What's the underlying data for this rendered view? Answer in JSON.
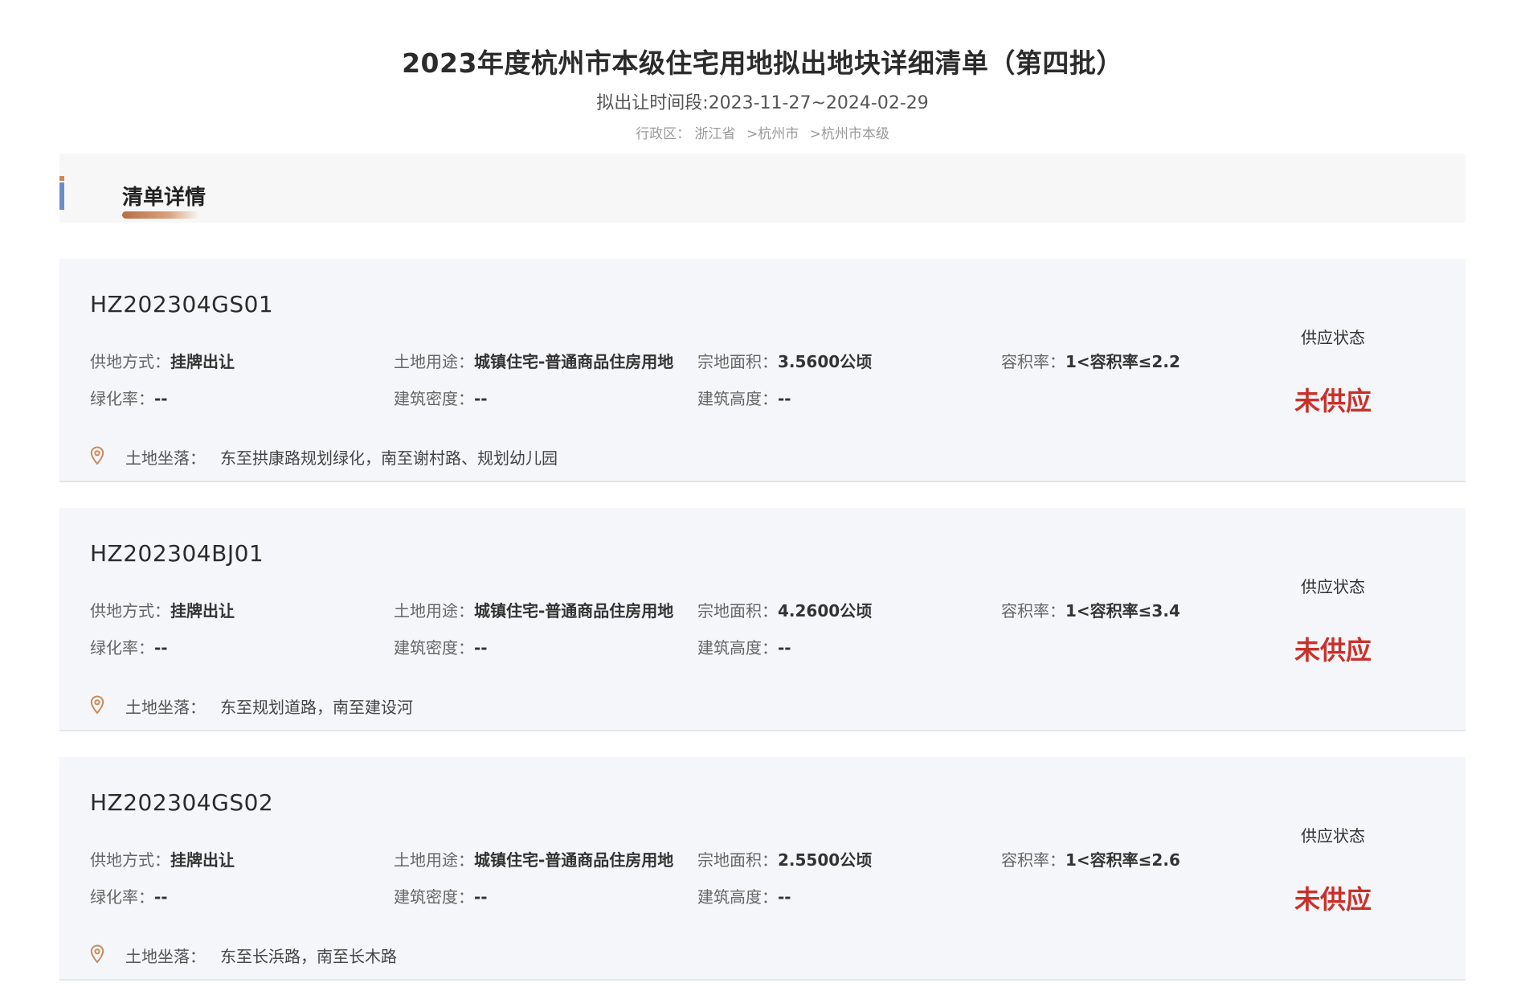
{
  "header": {
    "title": "2023年度杭州市本级住宅用地拟出地块详细清单（第四批）",
    "period": "拟出让时间段:2023-11-27~2024-02-29",
    "region_label": "行政区：",
    "region_province": "浙江省",
    "region_city": ">杭州市",
    "region_level": ">杭州市本级"
  },
  "section": {
    "title": "清单详情"
  },
  "labels": {
    "supply_method": "供地方式：",
    "land_use": "土地用途：",
    "area": "宗地面积：",
    "plot_ratio": "容积率：",
    "green_rate": "绿化率：",
    "building_density": "建筑密度：",
    "building_height": "建筑高度：",
    "location": "土地坐落：",
    "supply_status": "供应状态"
  },
  "parcels": [
    {
      "code": "HZ202304GS01",
      "supply_method": "挂牌出让",
      "land_use": "城镇住宅-普通商品住房用地",
      "area": "3.5600公顷",
      "plot_ratio": "1<容积率≤2.2",
      "green_rate": "--",
      "building_density": "--",
      "building_height": "--",
      "location": "东至拱康路规划绿化，南至谢村路、规划幼儿园",
      "status": "未供应"
    },
    {
      "code": "HZ202304BJ01",
      "supply_method": "挂牌出让",
      "land_use": "城镇住宅-普通商品住房用地",
      "area": "4.2600公顷",
      "plot_ratio": "1<容积率≤3.4",
      "green_rate": "--",
      "building_density": "--",
      "building_height": "--",
      "location": "东至规划道路，南至建设河",
      "status": "未供应"
    },
    {
      "code": "HZ202304GS02",
      "supply_method": "挂牌出让",
      "land_use": "城镇住宅-普通商品住房用地",
      "area": "2.5500公顷",
      "plot_ratio": "1<容积率≤2.6",
      "green_rate": "--",
      "building_density": "--",
      "building_height": "--",
      "location": "东至长浜路，南至长木路",
      "status": "未供应"
    }
  ],
  "colors": {
    "status_red": "#c8312b",
    "accent_blue": "#6b8ec2",
    "accent_copper": "#b96d44",
    "pin": "#c98a5a"
  },
  "icons": {
    "location": "location-pin-icon"
  }
}
